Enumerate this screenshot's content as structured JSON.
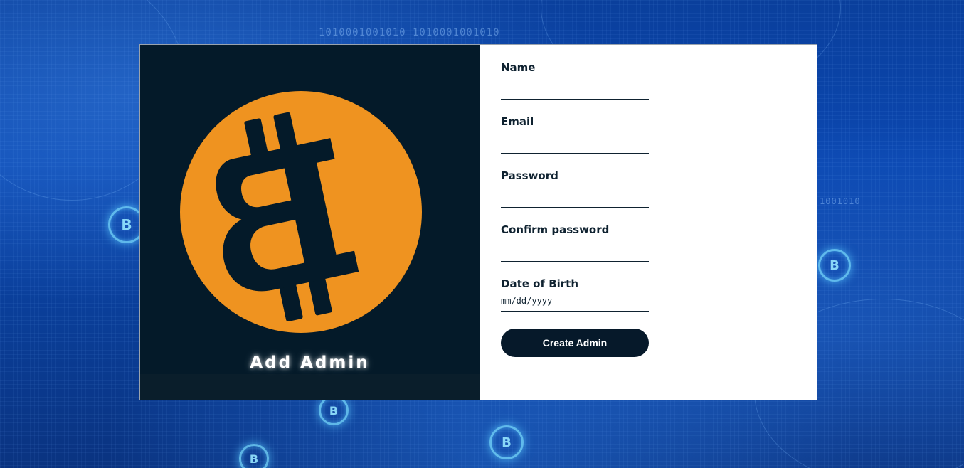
{
  "page": {
    "background_binary_text": "1010001001010 1010001001010",
    "background_binary_text_right": "1001010",
    "background_coin_symbol": "B"
  },
  "left_panel": {
    "title": "Add Admin",
    "logo_symbol": "bitcoin-icon",
    "colors": {
      "background": "#041a29",
      "coin_orange": "#ef9320",
      "coin_symbol": "#041a29"
    }
  },
  "form": {
    "fields": [
      {
        "label": "Name",
        "value": "",
        "type": "text"
      },
      {
        "label": "Email",
        "value": "",
        "type": "email"
      },
      {
        "label": "Password",
        "value": "",
        "type": "password"
      },
      {
        "label": "Confirm password",
        "value": "",
        "type": "password"
      },
      {
        "label": "Date of Birth",
        "placeholder": "mm/dd/yyyy",
        "type": "date"
      }
    ],
    "submit_label": "Create Admin",
    "colors": {
      "text": "#0f2230",
      "button_bg": "#06192a",
      "button_text": "#ffffff"
    }
  }
}
